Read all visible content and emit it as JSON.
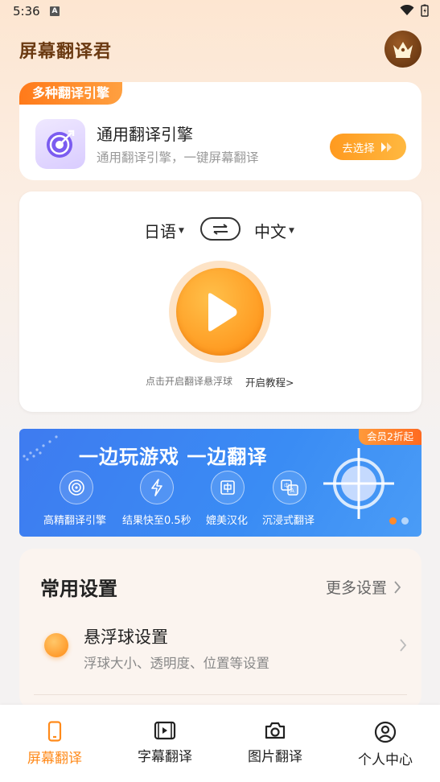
{
  "status_bar": {
    "time": "5:36",
    "notif_badge": "A"
  },
  "header": {
    "app_title": "屏幕翻译君",
    "crown_icon": "crown-icon"
  },
  "engine": {
    "tag": "多种翻译引擎",
    "title": "通用翻译引擎",
    "subtitle": "通用翻译引擎，一键屏幕翻译",
    "choose_label": "去选择",
    "icon": "target-icon"
  },
  "translate": {
    "source_lang": "日语",
    "target_lang": "中文",
    "hint": "点击开启翻译悬浮球",
    "tutorial": "开启教程>"
  },
  "banner": {
    "title": "一边玩游戏 一边翻译",
    "badge": "会员2折起",
    "features": [
      {
        "label": "高精翻译引擎",
        "icon": "target-icon"
      },
      {
        "label": "结果快至0.5秒",
        "icon": "lightning-icon"
      },
      {
        "label": "媲美汉化",
        "icon": "chinese-char-icon"
      },
      {
        "label": "沉浸式翻译",
        "icon": "translate-icon"
      }
    ],
    "colors": {
      "bg": "#3e7bf0",
      "badge": "#ff7a2a"
    }
  },
  "settings": {
    "title": "常用设置",
    "more_label": "更多设置",
    "float_title": "悬浮球设置",
    "float_sub": "浮球大小、透明度、位置等设置"
  },
  "nav": {
    "items": [
      {
        "label": "屏幕翻译",
        "icon": "phone-icon",
        "active": true
      },
      {
        "label": "字幕翻译",
        "icon": "video-icon",
        "active": false
      },
      {
        "label": "图片翻译",
        "icon": "camera-icon",
        "active": false
      },
      {
        "label": "个人中心",
        "icon": "user-icon",
        "active": false
      }
    ]
  },
  "colors": {
    "accent": "#ff8a1a",
    "title_brown": "#6b3a12"
  }
}
